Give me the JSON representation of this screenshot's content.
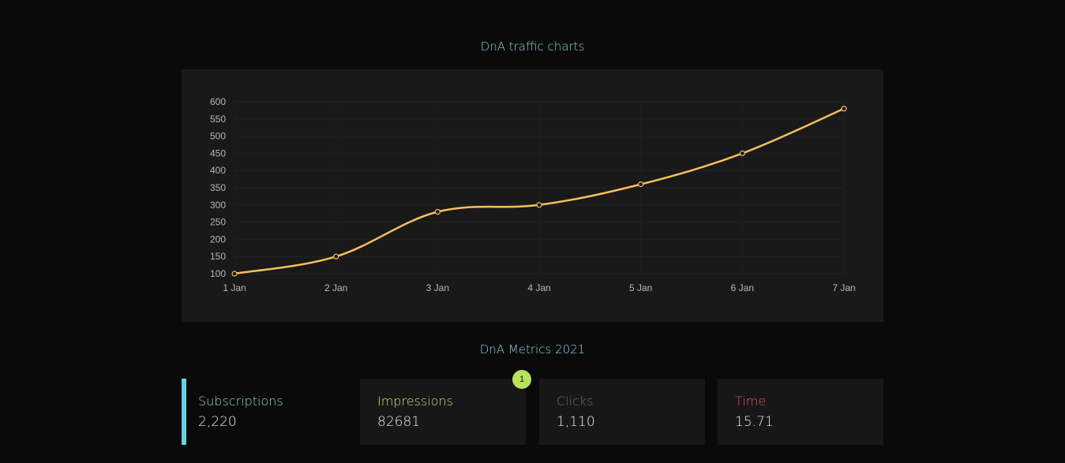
{
  "chart_section": {
    "title": "DnA traffic charts"
  },
  "chart_data": {
    "type": "line",
    "title": "",
    "xlabel": "",
    "ylabel": "",
    "categories": [
      "1 Jan",
      "2 Jan",
      "3 Jan",
      "4 Jan",
      "5 Jan",
      "6 Jan",
      "7 Jan"
    ],
    "series": [
      {
        "values": [
          100,
          150,
          280,
          300,
          360,
          450,
          580
        ],
        "color": "#f7c05a"
      }
    ],
    "yticks": [
      100,
      150,
      200,
      250,
      300,
      350,
      400,
      450,
      500,
      550,
      600
    ],
    "ylim": [
      100,
      600
    ],
    "grid": true,
    "legend": "none"
  },
  "metrics_section": {
    "title": "DnA Metrics 2021"
  },
  "metrics": [
    {
      "label": "Subscriptions",
      "value": "2,220",
      "color": "#8fd3dc"
    },
    {
      "label": "Impressions",
      "value": "82681",
      "color": "#c6e06a"
    },
    {
      "label": "Clicks",
      "value": "1,110",
      "color": "#6e6e6e"
    },
    {
      "label": "Time",
      "value": "15.71",
      "color": "#e0565e"
    }
  ],
  "badge": {
    "count": "1"
  },
  "colors": {
    "background": "#0a0a0a",
    "panel": "#191919",
    "accent": "#5fd4e6",
    "line": "#f7c05a"
  }
}
